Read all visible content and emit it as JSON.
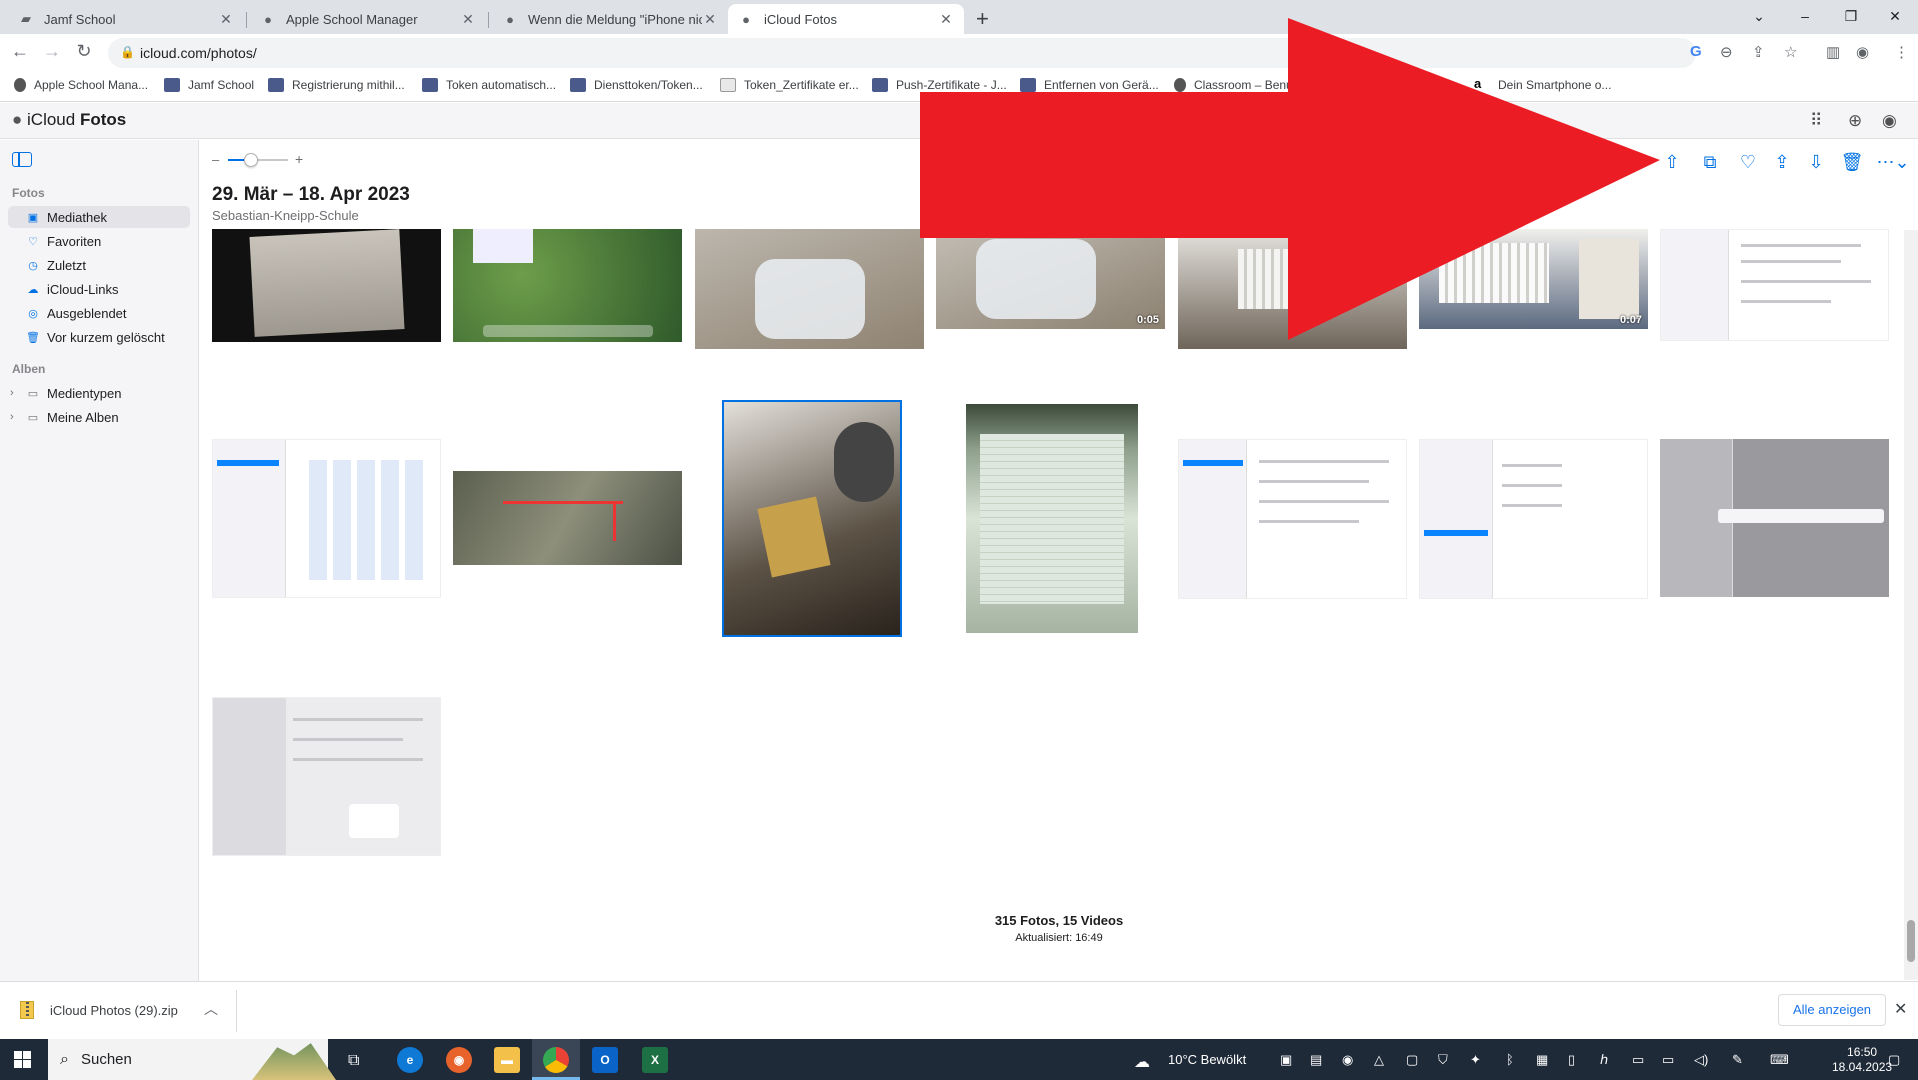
{
  "browser": {
    "tabs": [
      {
        "title": "Jamf School",
        "icon": "jamf-icon"
      },
      {
        "title": "Apple School Manager",
        "icon": "apple-icon"
      },
      {
        "title": "Wenn die Meldung \"iPhone nicht",
        "icon": "apple-icon"
      },
      {
        "title": "iCloud Fotos",
        "icon": "apple-icon",
        "active": true
      }
    ],
    "new_tab": "+",
    "url": "icloud.com/photos/",
    "bookmarks": [
      "Apple School Mana...",
      "Jamf School",
      "Registrierung mithil...",
      "Token automatisch...",
      "Diensttoken/Token...",
      "Token_Zertifikate er...",
      "Push-Zertifikate - J...",
      "Entfernen von Gerä...",
      "Classroom – Benu...",
      "Dein Smartphone o..."
    ]
  },
  "app": {
    "brand": "iCloud",
    "title": "Fotos"
  },
  "sidebar": {
    "section_photos": "Fotos",
    "items": [
      {
        "label": "Mediathek",
        "active": true
      },
      {
        "label": "Favoriten"
      },
      {
        "label": "Zuletzt"
      },
      {
        "label": "iCloud-Links"
      },
      {
        "label": "Ausgeblendet"
      },
      {
        "label": "Vor kurzem gelöscht"
      }
    ],
    "section_albums": "Alben",
    "albums": [
      {
        "label": "Medientypen"
      },
      {
        "label": "Meine Alben"
      }
    ]
  },
  "main": {
    "zoom_minus": "–",
    "zoom_plus": "+",
    "date_range": "29. Mär – 18. Apr 2023",
    "location": "Sebastian-Kneipp-Schule",
    "durations": [
      "0:05",
      "0:07"
    ],
    "summary": "315 Fotos, 15 Videos",
    "updated": "Aktualisiert: 16:49"
  },
  "download": {
    "file": "iCloud Photos (29).zip",
    "show_all": "Alle anzeigen"
  },
  "taskbar": {
    "search": "Suchen",
    "weather": "10°C  Bewölkt",
    "time": "16:50",
    "date": "18.04.2023"
  },
  "colors": {
    "accent": "#0071e3",
    "annotation_arrow": "#ec1c24"
  }
}
